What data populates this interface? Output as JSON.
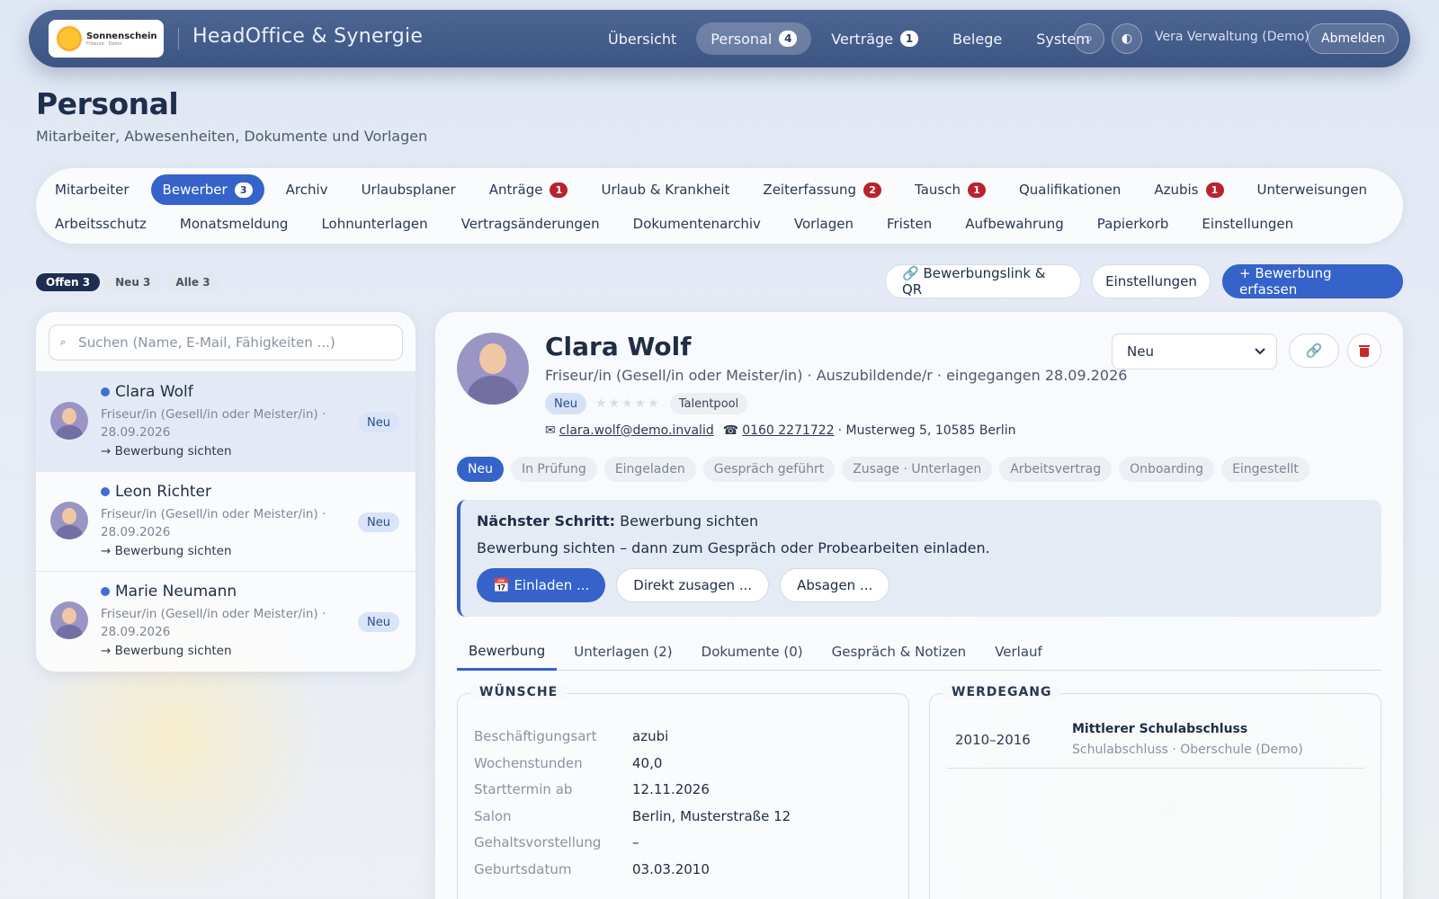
{
  "app": {
    "logo_name": "Sonnenschein",
    "logo_sub": "Friseure · Demo",
    "brand": "HeadOffice & Synergie",
    "nav": [
      {
        "label": "Übersicht",
        "badge": null
      },
      {
        "label": "Personal",
        "badge": "4"
      },
      {
        "label": "Verträge",
        "badge": "1"
      },
      {
        "label": "Belege",
        "badge": null
      },
      {
        "label": "System",
        "badge": null
      }
    ],
    "search_icon": "⌕",
    "theme_icon": "◐",
    "user": "Vera Verwaltung (Demo)",
    "logout": "Abmelden"
  },
  "page": {
    "title": "Personal",
    "subtitle": "Mitarbeiter, Abwesenheiten, Dokumente und Vorlagen"
  },
  "tabs_row1": [
    {
      "label": "Mitarbeiter",
      "badge": null
    },
    {
      "label": "Bewerber",
      "badge": "3"
    },
    {
      "label": "Archiv",
      "badge": null
    },
    {
      "label": "Urlaubsplaner",
      "badge": null
    },
    {
      "label": "Anträge",
      "badge": "1"
    },
    {
      "label": "Urlaub & Krankheit",
      "badge": null
    },
    {
      "label": "Zeiterfassung",
      "badge": "2"
    },
    {
      "label": "Tausch",
      "badge": "1"
    },
    {
      "label": "Qualifikationen",
      "badge": null
    },
    {
      "label": "Azubis",
      "badge": "1"
    },
    {
      "label": "Unterweisungen",
      "badge": null
    }
  ],
  "tabs_row2": [
    "Arbeitsschutz",
    "Monatsmeldung",
    "Lohnunterlagen",
    "Vertragsänderungen",
    "Dokumentenarchiv",
    "Vorlagen",
    "Fristen",
    "Aufbewahrung",
    "Papierkorb",
    "Einstellungen"
  ],
  "filters": [
    "Offen 3",
    "Neu 3",
    "Alle 3"
  ],
  "actions": {
    "link_qr": "🔗 Bewerbungslink & QR",
    "settings": "Einstellungen",
    "add": "+ Bewerbung erfassen"
  },
  "list": {
    "search_placeholder": "Suchen (Name, E-Mail, Fähigkeiten ...)",
    "items": [
      {
        "name": "Clara Wolf",
        "sub": "Friseur/in (Gesell/in oder Meister/in) · 28.09.2026",
        "next": "→ Bewerbung sichten",
        "badge": "Neu"
      },
      {
        "name": "Leon Richter",
        "sub": "Friseur/in (Gesell/in oder Meister/in) · 28.09.2026",
        "next": "→ Bewerbung sichten",
        "badge": "Neu"
      },
      {
        "name": "Marie Neumann",
        "sub": "Friseur/in (Gesell/in oder Meister/in) · 28.09.2026",
        "next": "→ Bewerbung sichten",
        "badge": "Neu"
      }
    ]
  },
  "detail": {
    "name": "Clara Wolf",
    "subtitle": "Friseur/in (Gesell/in oder Meister/in) · Auszubildende/r · eingegangen 28.09.2026",
    "status_tag": "Neu",
    "stars": "★★★★★",
    "rating": 0,
    "pool_tag": "Talentpool",
    "email_icon": "✉",
    "email": "clara.wolf@demo.invalid",
    "phone_icon": "☎",
    "phone": "0160 2271722",
    "address": "· Musterweg 5, 10585 Berlin",
    "status_select": "Neu",
    "link_icon": "🔗",
    "pipeline": [
      "Neu",
      "In Prüfung",
      "Eingeladen",
      "Gespräch geführt",
      "Zusage · Unterlagen",
      "Arbeitsvertrag",
      "Onboarding",
      "Eingestellt"
    ],
    "next_step_label": "Nächster Schritt:",
    "next_step_value": "Bewerbung sichten",
    "next_step_hint": "Bewerbung sichten – dann zum Gespräch oder Probearbeiten einladen.",
    "next_buttons": {
      "invite": "📅 Einladen ...",
      "accept": "Direkt zusagen ...",
      "reject": "Absagen ..."
    },
    "tabs": [
      "Bewerbung",
      "Unterlagen (2)",
      "Dokumente (0)",
      "Gespräch & Notizen",
      "Verlauf"
    ],
    "wishes_title": "WÜNSCHE",
    "wishes": [
      {
        "k": "Beschäftigungsart",
        "v": "azubi"
      },
      {
        "k": "Wochenstunden",
        "v": "40,0"
      },
      {
        "k": "Starttermin ab",
        "v": "12.11.2026"
      },
      {
        "k": "Salon",
        "v": "Berlin, Musterstraße 12"
      },
      {
        "k": "Gehaltsvorstellung",
        "v": "–"
      },
      {
        "k": "Geburtsdatum",
        "v": "03.03.2010"
      }
    ],
    "career_title": "WERDEGANG",
    "career": {
      "years": "2010–2016",
      "title": "Mittlerer Schulabschluss",
      "sub": "Schulabschluss · Oberschule (Demo)"
    }
  }
}
